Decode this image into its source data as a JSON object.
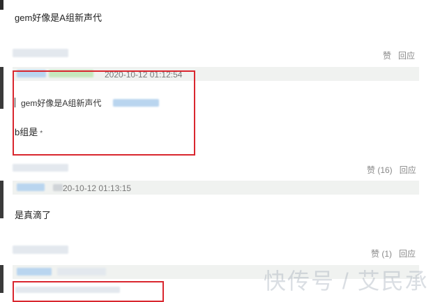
{
  "comments": [
    {
      "text": "gem好像是A组新声代"
    },
    {
      "actions": {
        "like": "赞",
        "reply": "回应"
      },
      "timestamp": "2020-10-12 01:12:54",
      "quote": "gem好像是A组新声代",
      "text": "b组是",
      "text_suffix": "*"
    },
    {
      "actions": {
        "like": "赞 (16)",
        "reply": "回应"
      },
      "timestamp": "20-10-12 01:13:15",
      "text": "是真滴了"
    },
    {
      "actions": {
        "like": "赞 (1)",
        "reply": "回应"
      }
    }
  ],
  "watermark": "快传号 / 艾民承"
}
